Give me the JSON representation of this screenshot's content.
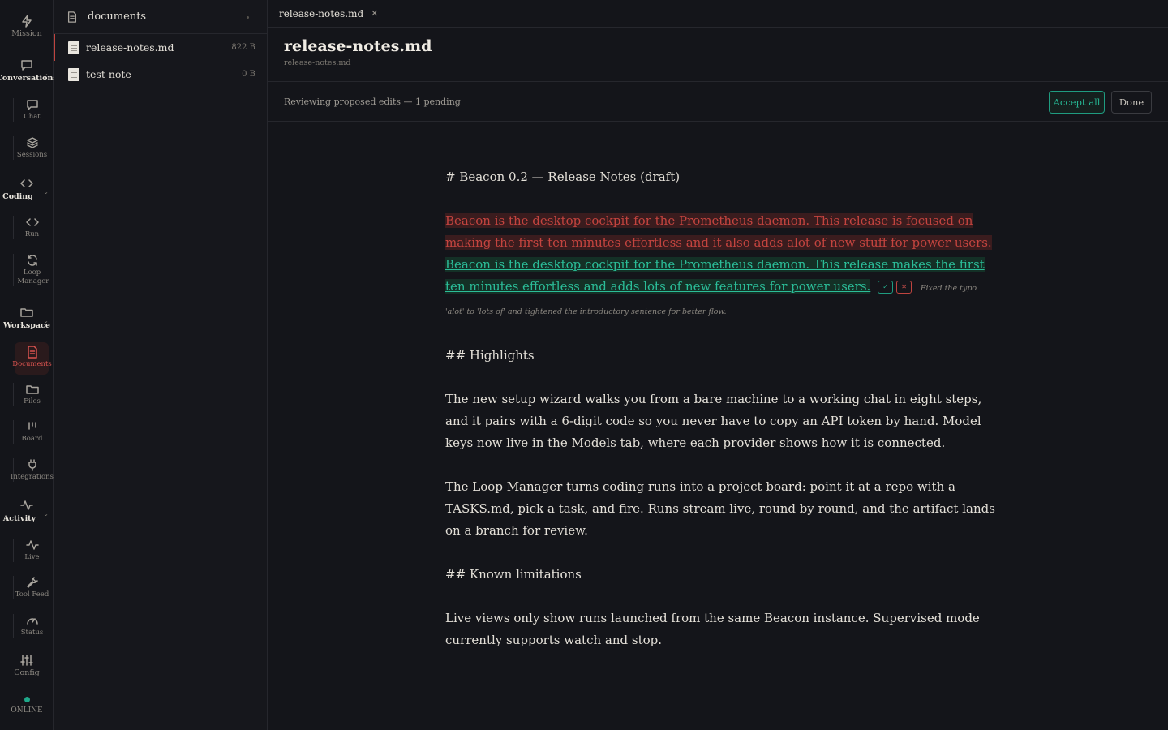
{
  "rail": {
    "mission": "Mission",
    "conversations": "Conversations",
    "chat": "Chat",
    "sessions": "Sessions",
    "coding": "Coding",
    "run": "Run",
    "loop_manager": "Loop Manager",
    "workspace": "Workspace",
    "documents": "Documents",
    "files": "Files",
    "board": "Board",
    "integrations": "Integrations",
    "activity": "Activity",
    "live": "Live",
    "tool_feed": "Tool Feed",
    "status": "Status",
    "config": "Config",
    "online": "ONLINE"
  },
  "docpanel": {
    "title": "documents",
    "items": [
      {
        "name": "release-notes.md",
        "size": "822 B"
      },
      {
        "name": "test note",
        "size": "0 B"
      }
    ]
  },
  "tab": {
    "label": "release-notes.md"
  },
  "doc": {
    "title": "release-notes.md",
    "path": "release-notes.md"
  },
  "review": {
    "status": "Reviewing proposed edits — 1 pending",
    "accept_all": "Accept all",
    "done": "Done"
  },
  "content": {
    "h1": "# Beacon 0.2 — Release Notes (draft)",
    "deleted": "Beacon is the desktop cockpit for the Prometheus daemon. This release is focused on making the first ten minutes effortless and it also adds alot of new stuff for power users.",
    "inserted": "Beacon is the desktop cockpit for the Prometheus daemon. This release makes the first ten minutes effortless and adds lots of new features for power users.",
    "note": "Fixed the typo 'alot' to 'lots of' and tightened the introductory sentence for better flow.",
    "h2_highlights": "## Highlights",
    "p1": "The new setup wizard walks you from a bare machine to a working chat in eight steps, and it pairs with a 6-digit code so you never have to copy an API token by hand. Model keys now live in the Models tab, where each provider shows how it is connected.",
    "p2": "The Loop Manager turns coding runs into a project board: point it at a repo with a TASKS.md, pick a task, and fire. Runs stream live, round by round, and the artifact lands on a branch for review.",
    "h2_limits": "## Known limitations",
    "p3": "Live views only show runs launched from the same Beacon instance. Supervised mode currently supports watch and stop."
  },
  "colors": {
    "accent_green": "#26b592",
    "accent_red": "#d9534f",
    "background": "#14151a"
  }
}
